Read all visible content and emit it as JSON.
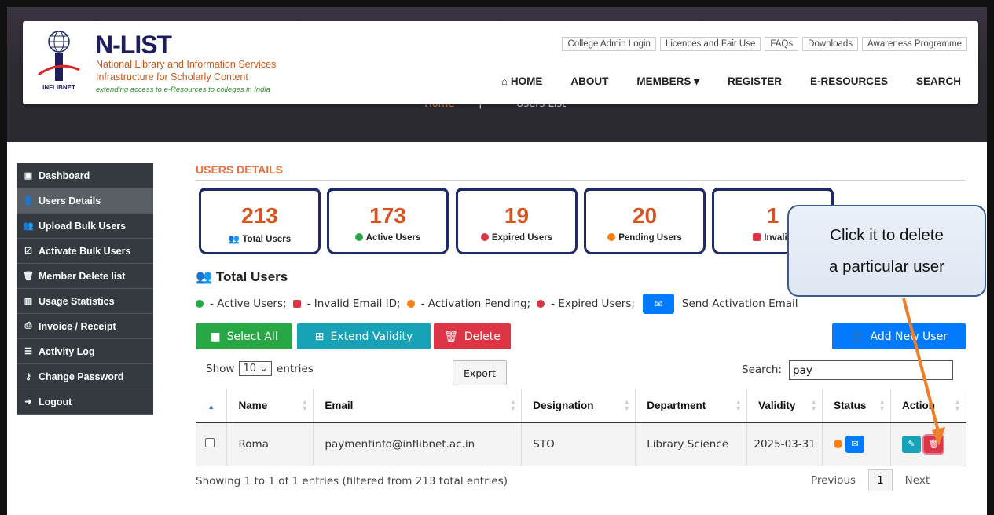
{
  "header": {
    "brand": "N-LIST",
    "tagline1": "National Library and Information Services",
    "tagline2": "Infrastructure for Scholarly Content",
    "tagline3": "extending access to e-Resources to colleges in India",
    "logo_text": "INFLIBNET",
    "top_links": [
      "College Admin Login",
      "Licences and Fair Use",
      "FAQs",
      "Downloads",
      "Awareness Programme"
    ],
    "nav": [
      "HOME",
      "ABOUT",
      "MEMBERS",
      "REGISTER",
      "E-RESOURCES",
      "SEARCH"
    ],
    "breadcrumb_home": "Home",
    "breadcrumb_current": "Users List"
  },
  "sidebar": {
    "items": [
      {
        "label": "Dashboard",
        "icon": "dashboard-icon"
      },
      {
        "label": "Users Details",
        "icon": "user-add-icon"
      },
      {
        "label": "Upload Bulk Users",
        "icon": "users-icon"
      },
      {
        "label": "Activate Bulk Users",
        "icon": "check-square-icon"
      },
      {
        "label": "Member Delete list",
        "icon": "trash-icon"
      },
      {
        "label": "Usage Statistics",
        "icon": "bar-chart-icon"
      },
      {
        "label": "Invoice / Receipt",
        "icon": "print-icon"
      },
      {
        "label": "Activity Log",
        "icon": "list-icon"
      },
      {
        "label": "Change Password",
        "icon": "key-icon"
      },
      {
        "label": "Logout",
        "icon": "sign-out-icon"
      }
    ],
    "active_index": 1
  },
  "main": {
    "section_title": "USERS DETAILS",
    "cards": [
      {
        "value": "213",
        "label": "Total Users",
        "icon": "users-icon",
        "color": "#1e2a66"
      },
      {
        "value": "173",
        "label": "Active Users",
        "icon": "check-circle-icon",
        "color": "#28a745"
      },
      {
        "value": "19",
        "label": "Expired Users",
        "icon": "x-circle-icon",
        "color": "#dc3545"
      },
      {
        "value": "20",
        "label": "Pending Users",
        "icon": "pending-icon",
        "color": "#fd7e14"
      },
      {
        "value": "1",
        "label": "Invalid",
        "icon": "envelope-x-icon",
        "color": "#dc3545"
      }
    ],
    "total_title": "Total Users",
    "legend": {
      "active": "- Active Users;",
      "invalid": "- Invalid Email ID;",
      "pending": "- Activation Pending;",
      "expired": "- Expired Users;",
      "send": "Send Activation Email"
    },
    "buttons": {
      "select_all": "Select All",
      "extend": "Extend Validity",
      "delete": "Delete",
      "add_user": "Add New User"
    },
    "show_label": "Show",
    "entries_value": "10",
    "entries_label": "entries",
    "export_label": "Export",
    "search_label": "Search:",
    "search_value": "pay",
    "table": {
      "columns": [
        "Name",
        "Email",
        "Designation",
        "Department",
        "Validity",
        "Status",
        "Action"
      ],
      "rows": [
        {
          "name": "Roma",
          "email": "paymentinfo@inflibnet.ac.in",
          "designation": "STO",
          "department": "Library Science",
          "validity": "2025-03-31"
        }
      ]
    },
    "info": "Showing 1 to 1 of 1 entries (filtered from 213 total entries)",
    "pager": {
      "previous": "Previous",
      "current": "1",
      "next": "Next"
    }
  },
  "callout": {
    "line1": "Click it to delete",
    "line2": "a particular user"
  },
  "colors": {
    "accent_orange": "#e8703a",
    "sidebar_bg": "#343a40",
    "btn_green": "#28a745",
    "btn_teal": "#17a2b8",
    "btn_red": "#dc3545",
    "btn_blue": "#007bff",
    "arrow": "#f07f2a"
  }
}
